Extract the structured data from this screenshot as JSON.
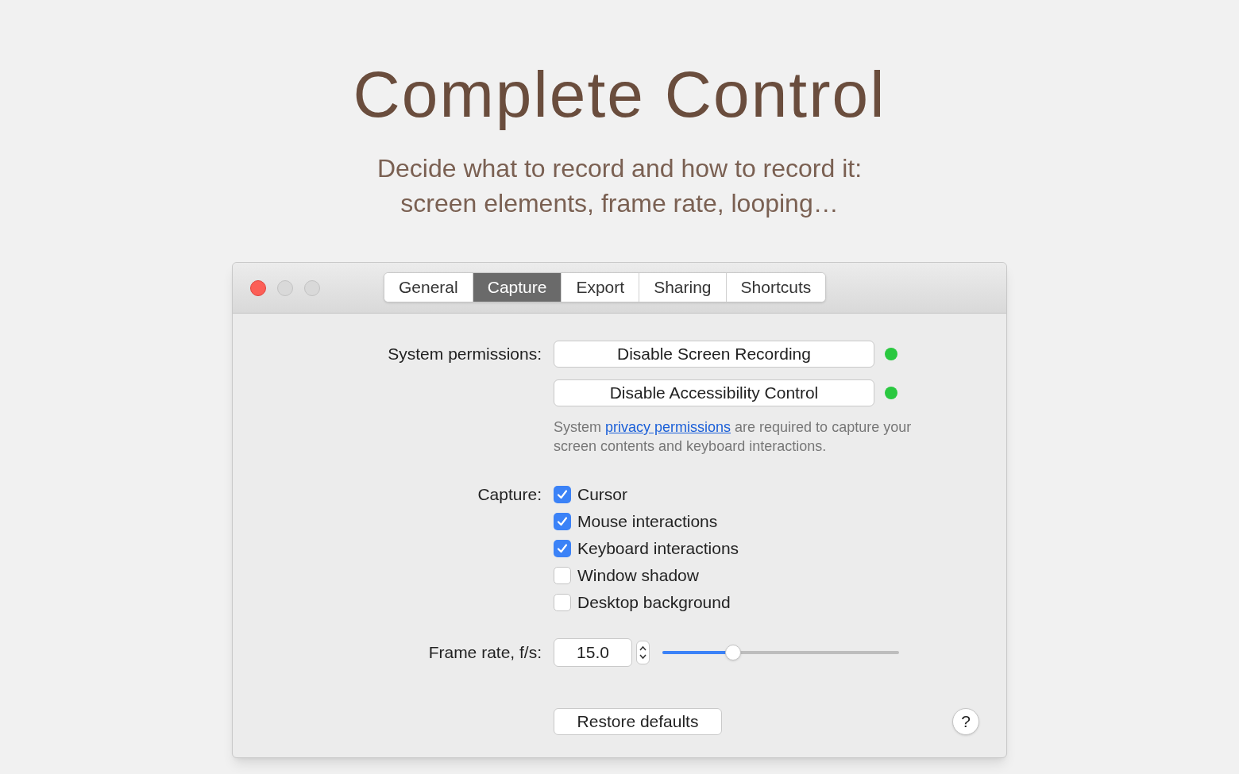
{
  "hero": {
    "title": "Complete Control",
    "subtitle": [
      "Decide what to record and how to record it:",
      "screen elements, frame rate, looping…"
    ]
  },
  "window": {
    "tabs": [
      {
        "label": "General",
        "selected": false
      },
      {
        "label": "Capture",
        "selected": true
      },
      {
        "label": "Export",
        "selected": false
      },
      {
        "label": "Sharing",
        "selected": false
      },
      {
        "label": "Shortcuts",
        "selected": false
      }
    ],
    "permissions": {
      "label": "System permissions:",
      "buttons": [
        {
          "label": "Disable Screen Recording",
          "color": "#2ac840"
        },
        {
          "label": "Disable Accessibility Control",
          "color": "#2ac840"
        }
      ],
      "note_before": "System ",
      "note_link": "privacy permissions",
      "note_after": " are required to capture your screen contents and keyboard interactions."
    },
    "capture": {
      "label": "Capture:",
      "options": [
        {
          "label": "Cursor",
          "checked": true
        },
        {
          "label": "Mouse interactions",
          "checked": true
        },
        {
          "label": "Keyboard interactions",
          "checked": true
        },
        {
          "label": "Window shadow",
          "checked": false
        },
        {
          "label": "Desktop background",
          "checked": false
        }
      ]
    },
    "frame_rate": {
      "label": "Frame rate, f/s:",
      "value": "15.0",
      "level": 0.3
    },
    "restore_button": "Restore defaults",
    "help_button": "?"
  }
}
